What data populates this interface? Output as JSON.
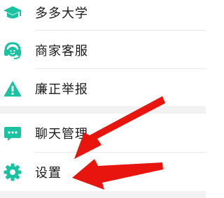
{
  "menu_items": [
    {
      "label": "多多大学",
      "icon": "graduation-cap-icon"
    },
    {
      "label": "商家客服",
      "icon": "headset-agent-icon"
    },
    {
      "label": "廉正举报",
      "icon": "warning-triangle-icon"
    },
    {
      "label": "聊天管理",
      "icon": "chat-bubble-icon"
    },
    {
      "label": "设置",
      "icon": "gear-icon"
    }
  ],
  "colors": {
    "icon_green": "#19c2a0",
    "arrow_red": "#e8150e",
    "text": "#1a1a1a",
    "page_bg": "#f2f2f2"
  }
}
